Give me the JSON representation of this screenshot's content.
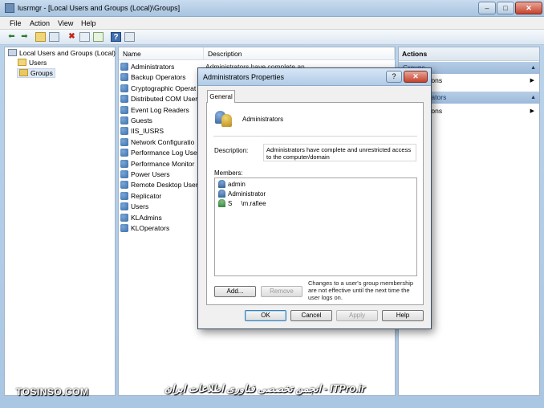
{
  "window": {
    "title": "lusrmgr - [Local Users and Groups (Local)\\Groups]",
    "min_glyph": "–",
    "max_glyph": "□",
    "close_glyph": "✕"
  },
  "menu": [
    "File",
    "Action",
    "View",
    "Help"
  ],
  "toolbar": {
    "icons": [
      "back-arrow-icon",
      "forward-arrow-icon",
      "up-folder-icon",
      "show-hide-tree-icon",
      "delete-icon",
      "properties-icon",
      "export-list-icon",
      "help-icon",
      "show-hide-action-pane-icon"
    ]
  },
  "tree": {
    "root": "Local Users and Groups (Local)",
    "children": [
      "Users",
      "Groups"
    ]
  },
  "list": {
    "columns": [
      "Name",
      "Description"
    ],
    "rows": [
      {
        "name": "Administrators",
        "desc": "Administrators have complete an..."
      },
      {
        "name": "Backup Operators",
        "desc": ""
      },
      {
        "name": "Cryptographic Operat",
        "desc": ""
      },
      {
        "name": "Distributed COM User",
        "desc": ""
      },
      {
        "name": "Event Log Readers",
        "desc": ""
      },
      {
        "name": "Guests",
        "desc": ""
      },
      {
        "name": "IIS_IUSRS",
        "desc": ""
      },
      {
        "name": "Network Configuratio",
        "desc": ""
      },
      {
        "name": "Performance Log User",
        "desc": ""
      },
      {
        "name": "Performance Monitor",
        "desc": ""
      },
      {
        "name": "Power Users",
        "desc": ""
      },
      {
        "name": "Remote Desktop Users",
        "desc": ""
      },
      {
        "name": "Replicator",
        "desc": ""
      },
      {
        "name": "Users",
        "desc": ""
      },
      {
        "name": "KLAdmins",
        "desc": ""
      },
      {
        "name": "KLOperators",
        "desc": ""
      }
    ]
  },
  "actions": {
    "header": "Actions",
    "section1": "Groups",
    "item1": "More Actions",
    "section2": "Administrators",
    "item2": "More Actions"
  },
  "dialog": {
    "title": "Administrators Properties",
    "help_glyph": "?",
    "close_glyph": "✕",
    "tab": "General",
    "group_name": "Administrators",
    "description_label": "Description:",
    "description": "Administrators have complete and unrestricted access to the computer/domain",
    "members_label": "Members:",
    "members": [
      {
        "name": "admin",
        "icon": "user-icon"
      },
      {
        "name": "Administrator",
        "icon": "user-icon"
      },
      {
        "name": "S     \\m.rafiee",
        "icon": "domain-user-icon"
      }
    ],
    "add_button": "Add...",
    "remove_button": "Remove",
    "note": "Changes to a user's group membership are not effective until the next time the user logs on.",
    "ok_button": "OK",
    "cancel_button": "Cancel",
    "apply_button": "Apply",
    "help_button": "Help"
  },
  "watermark": {
    "left": "TOSINSO.COM",
    "right": "ITPro.ir - انجمن تخصصی فناوری اطلاعات ایران"
  }
}
